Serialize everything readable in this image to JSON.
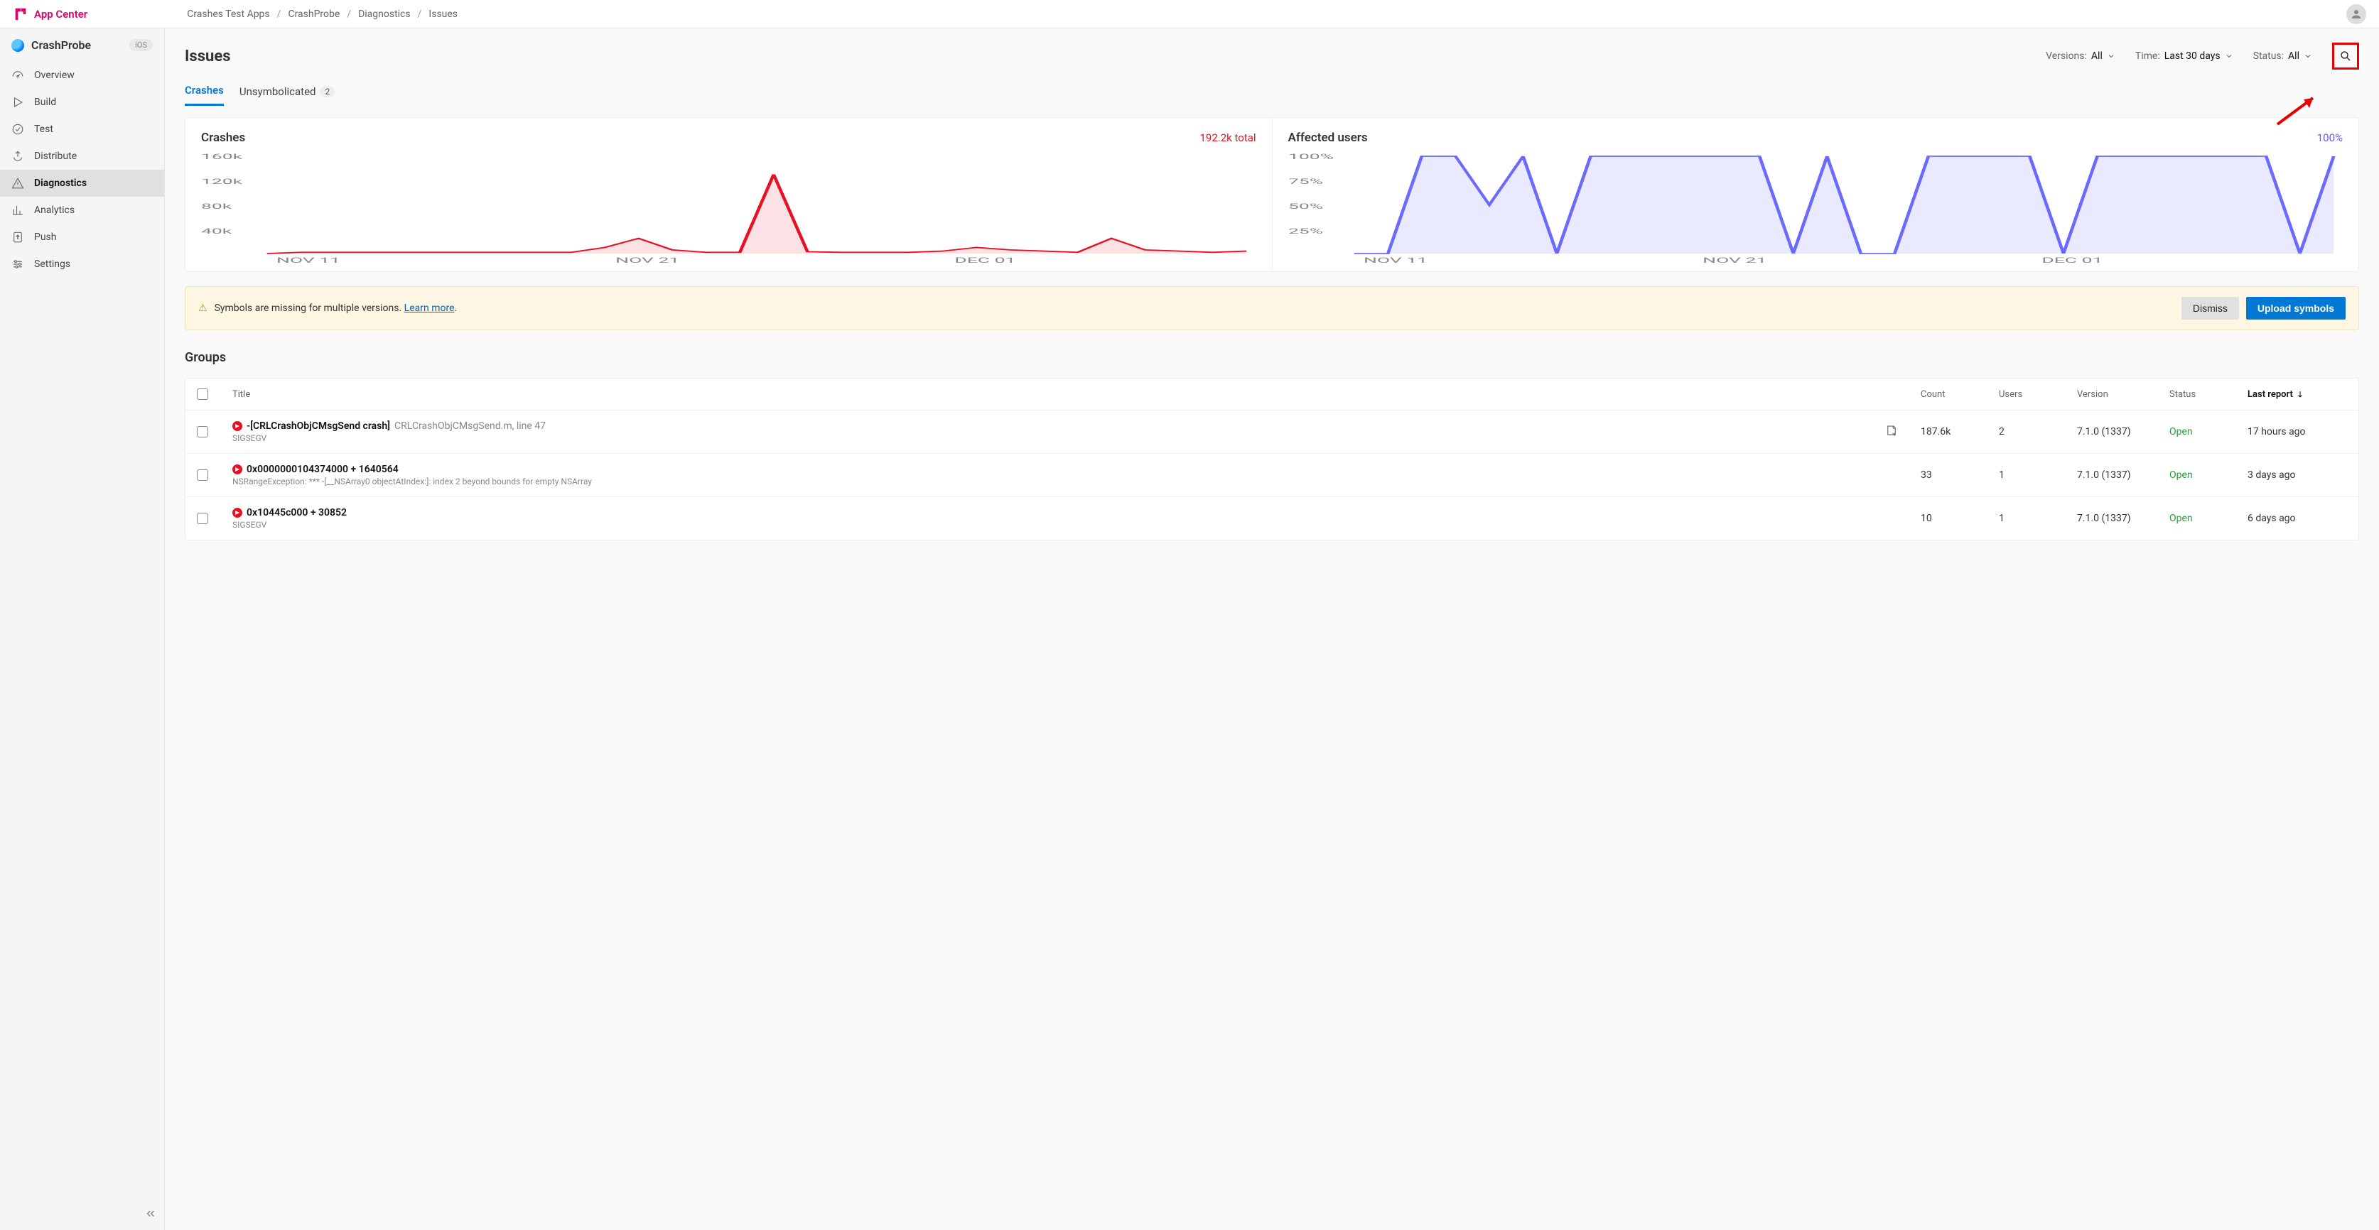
{
  "brand": "App Center",
  "breadcrumb": [
    "Crashes Test Apps",
    "CrashProbe",
    "Diagnostics",
    "Issues"
  ],
  "app": {
    "name": "CrashProbe",
    "platform": "iOS"
  },
  "nav": [
    {
      "label": "Overview"
    },
    {
      "label": "Build"
    },
    {
      "label": "Test"
    },
    {
      "label": "Distribute"
    },
    {
      "label": "Diagnostics"
    },
    {
      "label": "Analytics"
    },
    {
      "label": "Push"
    },
    {
      "label": "Settings"
    }
  ],
  "page": {
    "title": "Issues",
    "filters": {
      "versions_label": "Versions:",
      "versions_value": "All",
      "time_label": "Time:",
      "time_value": "Last 30 days",
      "status_label": "Status:",
      "status_value": "All"
    },
    "tabs": {
      "crashes": "Crashes",
      "unsymbolicated": "Unsymbolicated",
      "unsym_badge": "2"
    }
  },
  "charts": {
    "crashes": {
      "title": "Crashes",
      "total": "192.2k total"
    },
    "users": {
      "title": "Affected users",
      "total": "100%"
    }
  },
  "chart_data": [
    {
      "type": "area",
      "title": "Crashes",
      "ylabel": "",
      "xlabel": "",
      "ylim": [
        0,
        160000
      ],
      "y_ticks": [
        "160k",
        "120k",
        "80k",
        "40k"
      ],
      "x_ticks": [
        "NOV 11",
        "NOV 21",
        "DEC 01"
      ],
      "x": [
        0,
        1,
        2,
        3,
        4,
        5,
        6,
        7,
        8,
        9,
        10,
        11,
        12,
        13,
        14,
        15,
        16,
        17,
        18,
        19,
        20,
        21,
        22,
        23,
        24,
        25,
        26,
        27,
        28,
        29
      ],
      "values": [
        0,
        2000,
        2000,
        2000,
        2000,
        2000,
        2000,
        2000,
        2000,
        2000,
        10000,
        25000,
        6000,
        2000,
        2000,
        130000,
        3000,
        2000,
        2000,
        2000,
        4000,
        10000,
        6000,
        4000,
        2000,
        25000,
        6000,
        4000,
        2000,
        4000
      ],
      "color": "#e81123"
    },
    {
      "type": "area",
      "title": "Affected users",
      "ylabel": "",
      "xlabel": "",
      "ylim": [
        0,
        100
      ],
      "y_ticks": [
        "100%",
        "75%",
        "50%",
        "25%"
      ],
      "x_ticks": [
        "NOV 11",
        "NOV 21",
        "DEC 01"
      ],
      "x": [
        0,
        1,
        2,
        3,
        4,
        5,
        6,
        7,
        8,
        9,
        10,
        11,
        12,
        13,
        14,
        15,
        16,
        17,
        18,
        19,
        20,
        21,
        22,
        23,
        24,
        25,
        26,
        27,
        28,
        29
      ],
      "values": [
        0,
        0,
        100,
        100,
        50,
        100,
        0,
        100,
        100,
        100,
        100,
        100,
        100,
        0,
        100,
        0,
        0,
        100,
        100,
        100,
        100,
        0,
        100,
        100,
        100,
        100,
        100,
        100,
        0,
        100
      ],
      "color": "#6a6aff"
    }
  ],
  "alert": {
    "text": "Symbols are missing for multiple versions. ",
    "link": "Learn more",
    "dismiss": "Dismiss",
    "upload": "Upload symbols"
  },
  "groups": {
    "title": "Groups",
    "columns": {
      "title": "Title",
      "count": "Count",
      "users": "Users",
      "version": "Version",
      "status": "Status",
      "last": "Last report"
    },
    "rows": [
      {
        "method": "-[CRLCrashObjCMsgSend crash]",
        "file": "CRLCrashObjCMsgSend.m, line 47",
        "sub": "SIGSEGV",
        "has_note": true,
        "count": "187.6k",
        "users": "2",
        "version": "7.1.0 (1337)",
        "status": "Open",
        "last": "17 hours ago"
      },
      {
        "method": "0x0000000104374000 + 1640564",
        "file": "",
        "sub": "NSRangeException: *** -[__NSArray0 objectAtIndex:]: index 2 beyond bounds for empty NSArray",
        "has_note": false,
        "count": "33",
        "users": "1",
        "version": "7.1.0 (1337)",
        "status": "Open",
        "last": "3 days ago"
      },
      {
        "method": "0x10445c000 + 30852",
        "file": "",
        "sub": "SIGSEGV",
        "has_note": false,
        "count": "10",
        "users": "1",
        "version": "7.1.0 (1337)",
        "status": "Open",
        "last": "6 days ago"
      }
    ]
  }
}
